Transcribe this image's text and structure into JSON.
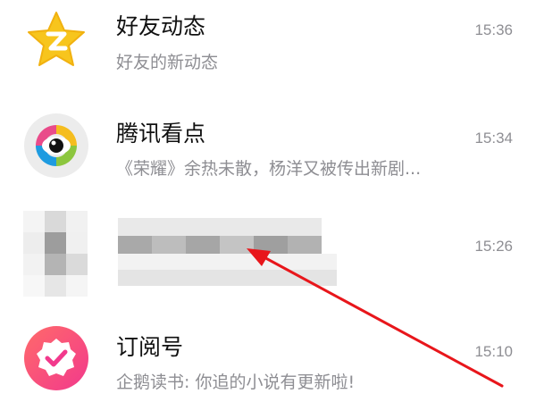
{
  "conversations": [
    {
      "title": "好友动态",
      "preview": "好友的新动态",
      "time": "15:36",
      "icon": "star-qzone-icon"
    },
    {
      "title": "腾讯看点",
      "preview": "《荣耀》余热未散，杨洋又被传出新剧...",
      "time": "15:34",
      "icon": "eye-kandian-icon"
    },
    {
      "title": "",
      "preview": "",
      "time": "15:26",
      "icon": "pixelated-avatar"
    },
    {
      "title": "订阅号",
      "preview": "企鹅读书: 你追的小说有更新啦!",
      "time": "15:10",
      "icon": "badge-check-icon"
    }
  ],
  "colors": {
    "title": "#111111",
    "secondary": "#8e8e93",
    "annotation_arrow": "#e8161b",
    "qzone_star": "#f7c51d",
    "subscription_badge": "#ff4f7a"
  }
}
